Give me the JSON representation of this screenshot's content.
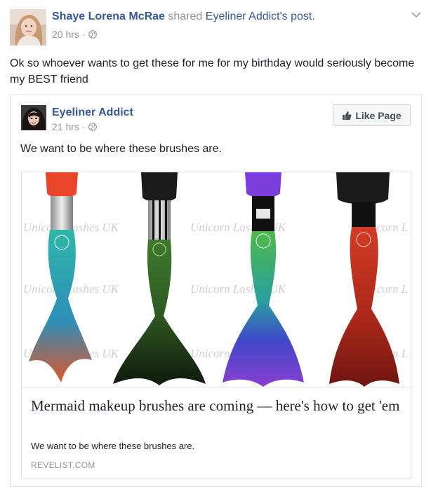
{
  "sharer": {
    "name": "Shaye Lorena McRae",
    "verb": "shared",
    "page_possessive": "Eyeliner Addict's",
    "object": "post.",
    "time": "20 hrs",
    "separator": "·",
    "privacy_icon": "globe-icon"
  },
  "message": "Ok so whoever wants to get these for me for my birthday would seriously become my BEST friend",
  "shared": {
    "page_name": "Eyeliner Addict",
    "time": "21 hrs",
    "separator": "·",
    "privacy_icon": "globe-icon",
    "like_button": "Like Page",
    "like_icon": "thumbs-up-icon",
    "message": "We want to be where these brushes are."
  },
  "attachment": {
    "watermark": "Unicorn Lashes UK",
    "title": "Mermaid makeup brushes are coming — here's how to get 'em",
    "description": "We want to be where these brushes are.",
    "domain": "REVELIST.COM"
  },
  "colors": {
    "link_blue": "#365899",
    "meta_gray": "#90949c",
    "text": "#1d2129",
    "border": "#dddfe2"
  }
}
